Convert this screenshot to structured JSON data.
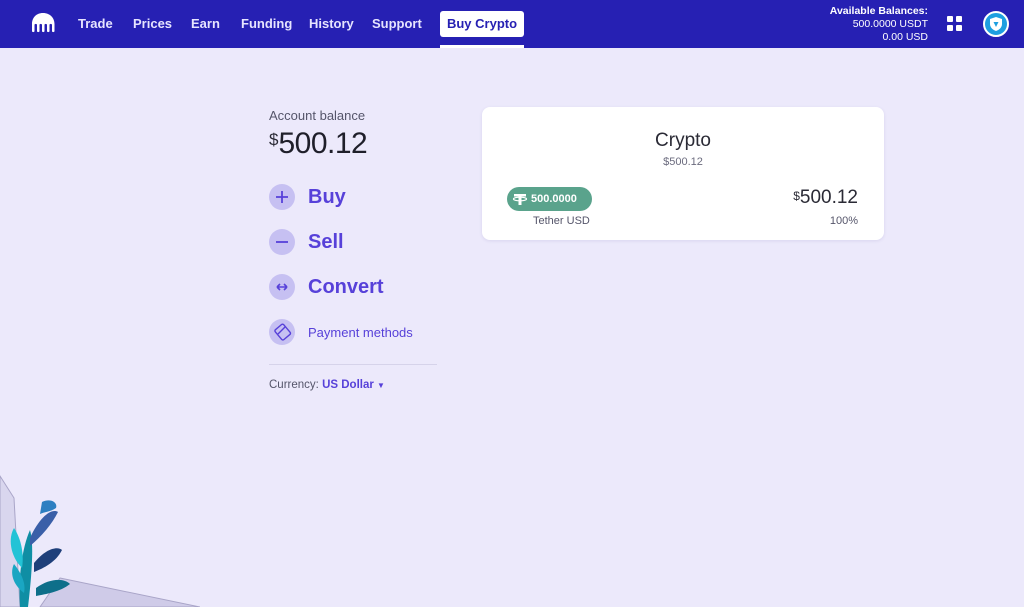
{
  "header": {
    "nav": [
      {
        "label": "Trade"
      },
      {
        "label": "Prices"
      },
      {
        "label": "Earn"
      },
      {
        "label": "Funding"
      },
      {
        "label": "History"
      },
      {
        "label": "Support"
      }
    ],
    "active_nav": {
      "label": "Buy Crypto"
    },
    "balances": {
      "title": "Available Balances:",
      "usdt": "500.0000 USDT",
      "usd": "0.00 USD"
    },
    "icons": {
      "logo": "kraken-logo-icon",
      "apps": "grid-icon",
      "avatar": "shield-avatar-icon"
    }
  },
  "account": {
    "label": "Account balance",
    "currency_symbol": "$",
    "amount": "500.12"
  },
  "actions": [
    {
      "label": "Buy",
      "icon": "plus-icon"
    },
    {
      "label": "Sell",
      "icon": "minus-icon"
    },
    {
      "label": "Convert",
      "icon": "convert-arrows-icon"
    },
    {
      "label": "Payment methods",
      "icon": "payment-card-icon"
    }
  ],
  "currency": {
    "label": "Currency:",
    "value": "US Dollar"
  },
  "crypto_card": {
    "title": "Crypto",
    "subtitle": "$500.12",
    "asset": {
      "amount": "500.0000",
      "name": "Tether USD",
      "value_symbol": "$",
      "value": "500.12",
      "percent": "100%",
      "icon": "tether-icon",
      "color": "#5aa38c"
    }
  },
  "colors": {
    "topbar": "#2620b3",
    "accent": "#5741d9",
    "background": "#ece9fb"
  }
}
